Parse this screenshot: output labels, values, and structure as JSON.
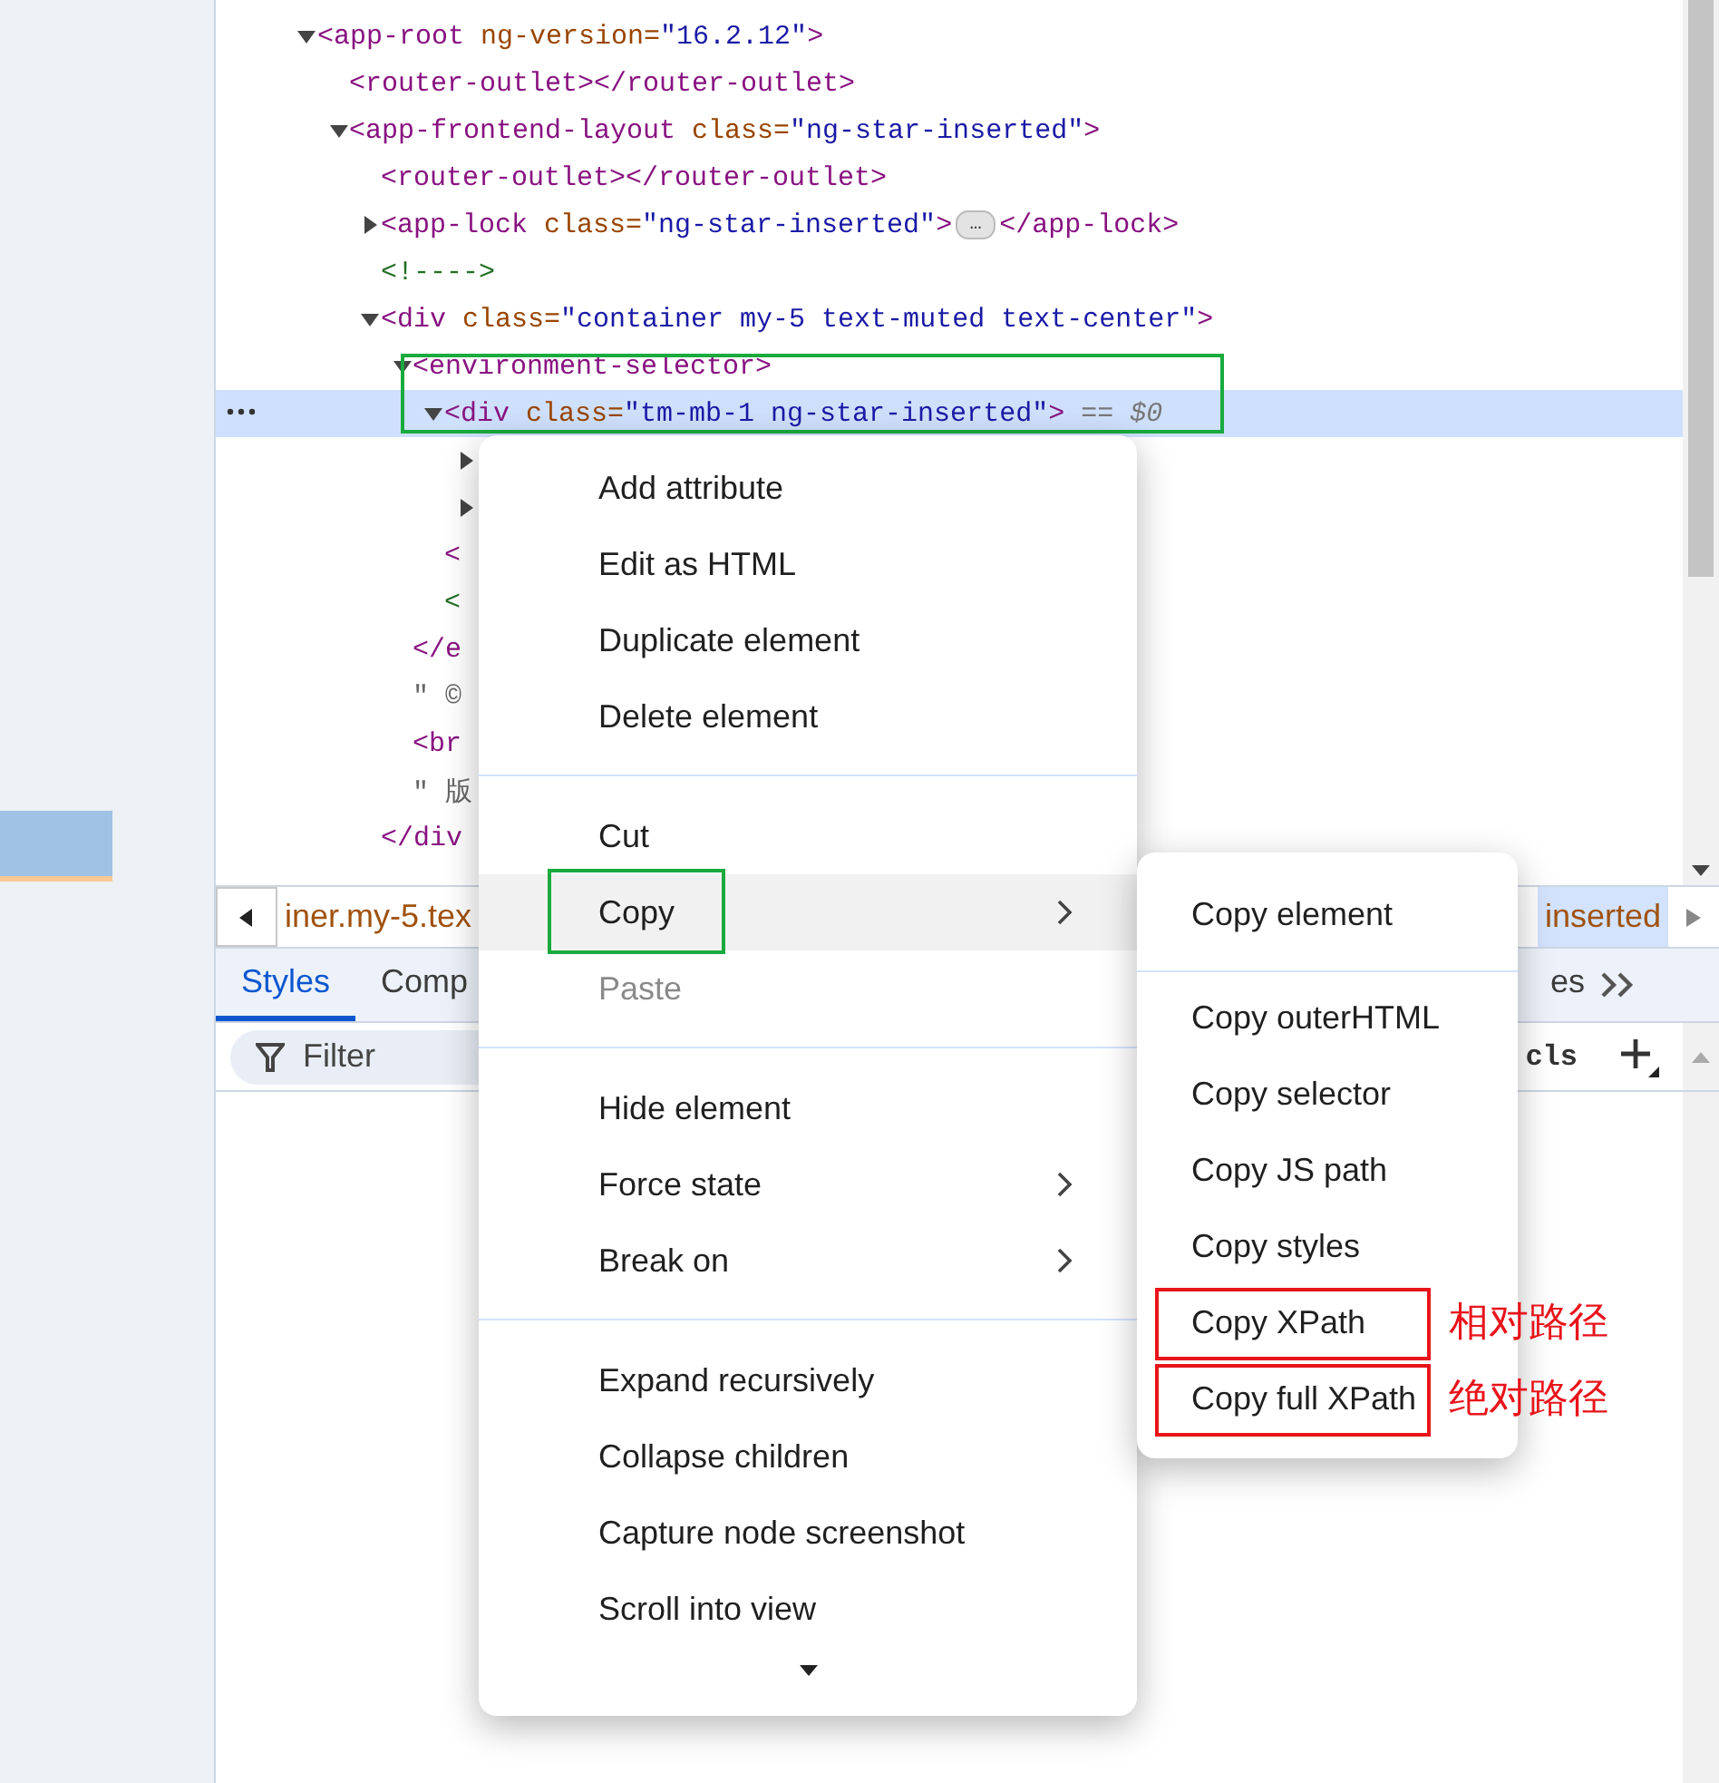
{
  "tree": {
    "nodes": [
      {
        "selected": false,
        "annotation_box": false,
        "expanded": true,
        "tokens": [
          {
            "kind": "tag",
            "text": "<app-root "
          },
          {
            "kind": "attr",
            "text": "ng-version="
          },
          {
            "kind": "value",
            "text": "\"16.2.12\""
          },
          {
            "kind": "tag",
            "text": ">"
          }
        ],
        "children": [
          {
            "selected": false,
            "annotation_box": false,
            "tokens": [
              {
                "kind": "tag",
                "text": "<router-outlet></router-outlet>"
              }
            ]
          },
          {
            "selected": false,
            "annotation_box": false,
            "expanded": true,
            "tokens": [
              {
                "kind": "tag",
                "text": "<app-frontend-layout "
              },
              {
                "kind": "attr",
                "text": "class="
              },
              {
                "kind": "value",
                "text": "\"ng-star-inserted\""
              },
              {
                "kind": "tag",
                "text": ">"
              }
            ],
            "children": [
              {
                "selected": false,
                "annotation_box": false,
                "tokens": [
                  {
                    "kind": "tag",
                    "text": "<router-outlet></router-outlet>"
                  }
                ]
              },
              {
                "selected": false,
                "annotation_box": false,
                "expanded": false,
                "tokens": [
                  {
                    "kind": "tag",
                    "text": "<app-lock "
                  },
                  {
                    "kind": "attr",
                    "text": "class="
                  },
                  {
                    "kind": "value",
                    "text": "\"ng-star-inserted\""
                  },
                  {
                    "kind": "tag",
                    "text": ">"
                  },
                  {
                    "kind": "badge",
                    "text": "…"
                  },
                  {
                    "kind": "tag",
                    "text": "</app-lock>"
                  }
                ]
              },
              {
                "selected": false,
                "annotation_box": false,
                "tokens": [
                  {
                    "kind": "comment",
                    "text": "<!---->"
                  }
                ]
              },
              {
                "selected": false,
                "annotation_box": false,
                "expanded": true,
                "tokens": [
                  {
                    "kind": "tag",
                    "text": "<div "
                  },
                  {
                    "kind": "attr",
                    "text": "class="
                  },
                  {
                    "kind": "value",
                    "text": "\"container my-5 text-muted text-center\""
                  },
                  {
                    "kind": "tag",
                    "text": ">"
                  }
                ],
                "children": [
                  {
                    "selected": false,
                    "annotation_box": false,
                    "expanded": true,
                    "tokens": [
                      {
                        "kind": "tag",
                        "text": "<environment-selector>"
                      }
                    ],
                    "children": [
                      {
                        "selected": true,
                        "annotation_box": true,
                        "expanded": true,
                        "tokens": [
                          {
                            "kind": "tag",
                            "text": "<div "
                          },
                          {
                            "kind": "attr",
                            "text": "class="
                          },
                          {
                            "kind": "value",
                            "text": "\"tm-mb-1 ng-star-inserted\""
                          },
                          {
                            "kind": "tag",
                            "text": ">"
                          },
                          {
                            "kind": "hint",
                            "text": " == $0"
                          }
                        ],
                        "children": [
                          {
                            "selected": false,
                            "annotation_box": false,
                            "expanded": false
                          },
                          {
                            "selected": false,
                            "annotation_box": false,
                            "expanded": false
                          }
                        ],
                        "close": [
                          {
                            "kind": "tag",
                            "text": "<"
                          }
                        ]
                      },
                      {
                        "selected": false,
                        "annotation_box": false,
                        "tokens": [
                          {
                            "kind": "comment",
                            "text": "<"
                          }
                        ]
                      }
                    ],
                    "close": [
                      {
                        "kind": "tag",
                        "text": "</e"
                      }
                    ]
                  },
                  {
                    "selected": false,
                    "annotation_box": false,
                    "tokens": [
                      {
                        "kind": "text",
                        "text": "\" ©"
                      }
                    ]
                  },
                  {
                    "selected": false,
                    "annotation_box": false,
                    "tokens": [
                      {
                        "kind": "tag",
                        "text": "<br"
                      }
                    ]
                  },
                  {
                    "selected": false,
                    "annotation_box": false,
                    "tokens": [
                      {
                        "kind": "text",
                        "text": "\" 版"
                      }
                    ]
                  }
                ],
                "close": [
                  {
                    "kind": "tag",
                    "text": "</div"
                  }
                ]
              }
            ]
          }
        ]
      }
    ]
  },
  "breadcrumbs": [
    {
      "text": "iner.my-5.tex",
      "selected": false
    },
    {
      "text": "inserted",
      "selected": true
    }
  ],
  "tabs": [
    {
      "label": "Styles",
      "selected": true
    },
    {
      "label": "Comp",
      "selected": false
    }
  ],
  "tabs_right": [
    {
      "label": "es",
      "selected": false
    }
  ],
  "filter": {
    "placeholder": "Filter",
    "cls": "cls"
  },
  "menu": {
    "groups": [
      [
        {
          "label": "Add attribute",
          "submenu": false,
          "selected": false,
          "disabled": false,
          "annotation_box": false
        },
        {
          "label": "Edit as HTML",
          "submenu": false,
          "selected": false,
          "disabled": false,
          "annotation_box": false
        },
        {
          "label": "Duplicate element",
          "submenu": false,
          "selected": false,
          "disabled": false,
          "annotation_box": false
        },
        {
          "label": "Delete element",
          "submenu": false,
          "selected": false,
          "disabled": false,
          "annotation_box": false
        }
      ],
      [
        {
          "label": "Cut",
          "submenu": false,
          "selected": false,
          "disabled": false,
          "annotation_box": false
        },
        {
          "label": "Copy",
          "submenu": true,
          "selected": true,
          "disabled": false,
          "annotation_box": true
        },
        {
          "label": "Paste",
          "submenu": false,
          "selected": false,
          "disabled": true,
          "annotation_box": false
        }
      ],
      [
        {
          "label": "Hide element",
          "submenu": false,
          "selected": false,
          "disabled": false,
          "annotation_box": false
        },
        {
          "label": "Force state",
          "submenu": true,
          "selected": false,
          "disabled": false,
          "annotation_box": false
        },
        {
          "label": "Break on",
          "submenu": true,
          "selected": false,
          "disabled": false,
          "annotation_box": false
        }
      ],
      [
        {
          "label": "Expand recursively",
          "submenu": false,
          "selected": false,
          "disabled": false,
          "annotation_box": false
        },
        {
          "label": "Collapse children",
          "submenu": false,
          "selected": false,
          "disabled": false,
          "annotation_box": false
        },
        {
          "label": "Capture node screenshot",
          "submenu": false,
          "selected": false,
          "disabled": false,
          "annotation_box": false
        },
        {
          "label": "Scroll into view",
          "submenu": false,
          "selected": false,
          "disabled": false,
          "annotation_box": false
        }
      ]
    ]
  },
  "submenu": {
    "groups": [
      [
        {
          "label": "Copy element",
          "annotation_box": false
        }
      ],
      [
        {
          "label": "Copy outerHTML",
          "annotation_box": false
        },
        {
          "label": "Copy selector",
          "annotation_box": false
        },
        {
          "label": "Copy JS path",
          "annotation_box": false
        },
        {
          "label": "Copy styles",
          "annotation_box": false
        },
        {
          "label": "Copy XPath",
          "annotation_box": true,
          "note": "相对路径"
        },
        {
          "label": "Copy full XPath",
          "annotation_box": true,
          "note": "绝对路径"
        }
      ]
    ]
  }
}
